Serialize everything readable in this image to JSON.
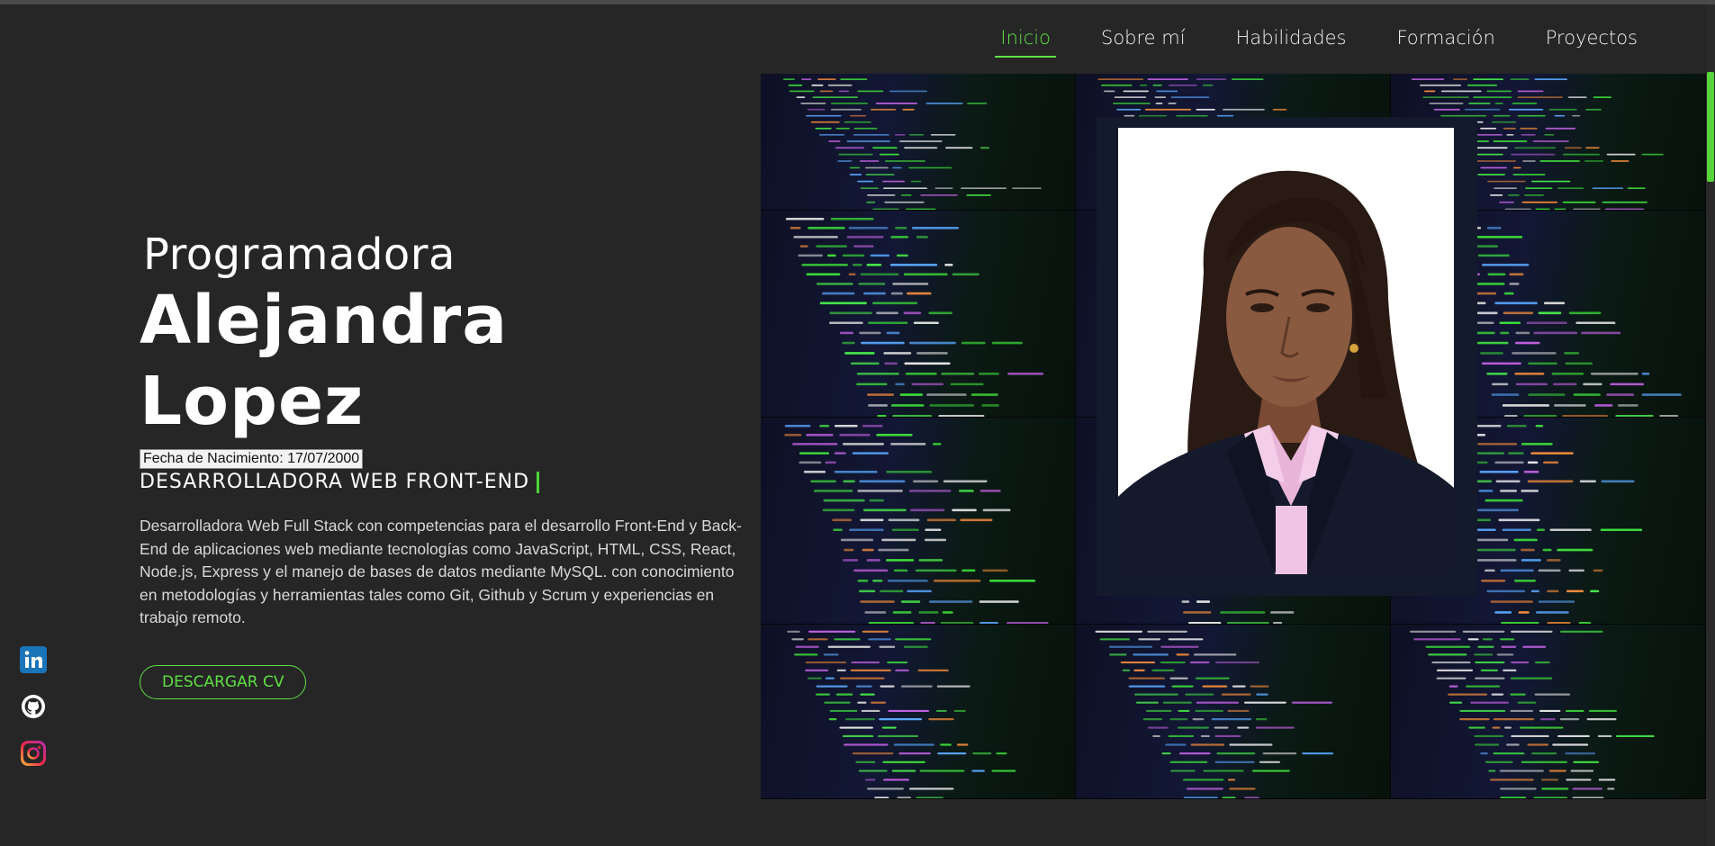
{
  "nav": {
    "items": [
      {
        "label": "Inicio",
        "active": true
      },
      {
        "label": "Sobre mí",
        "active": false
      },
      {
        "label": "Habilidades",
        "active": false
      },
      {
        "label": "Formación",
        "active": false
      },
      {
        "label": "Proyectos",
        "active": false
      }
    ]
  },
  "hero": {
    "subtitle": "Programadora",
    "name": "Alejandra Lopez",
    "birth": "Fecha de Nacimiento: 17/07/2000",
    "role": "DESARROLLADORA WEB FRONT-END",
    "description": "Desarrolladora Web Full Stack con competencias para el desarrollo Front-End y Back-End de aplicaciones web mediante tecnologías como JavaScript, HTML, CSS, React, Node.js, Express y el manejo de bases de datos mediante MySQL. con conocimiento en metodologías y herramientas tales como Git, Github y Scrum y experiencias en trabajo remoto.",
    "cv_button": "DESCARGAR CV"
  },
  "socials": [
    {
      "icon": "linkedin-icon"
    },
    {
      "icon": "github-icon"
    },
    {
      "icon": "instagram-icon"
    }
  ],
  "colors": {
    "background": "#262626",
    "accent": "#5ee043",
    "portrait_frame": "#131a2b"
  }
}
